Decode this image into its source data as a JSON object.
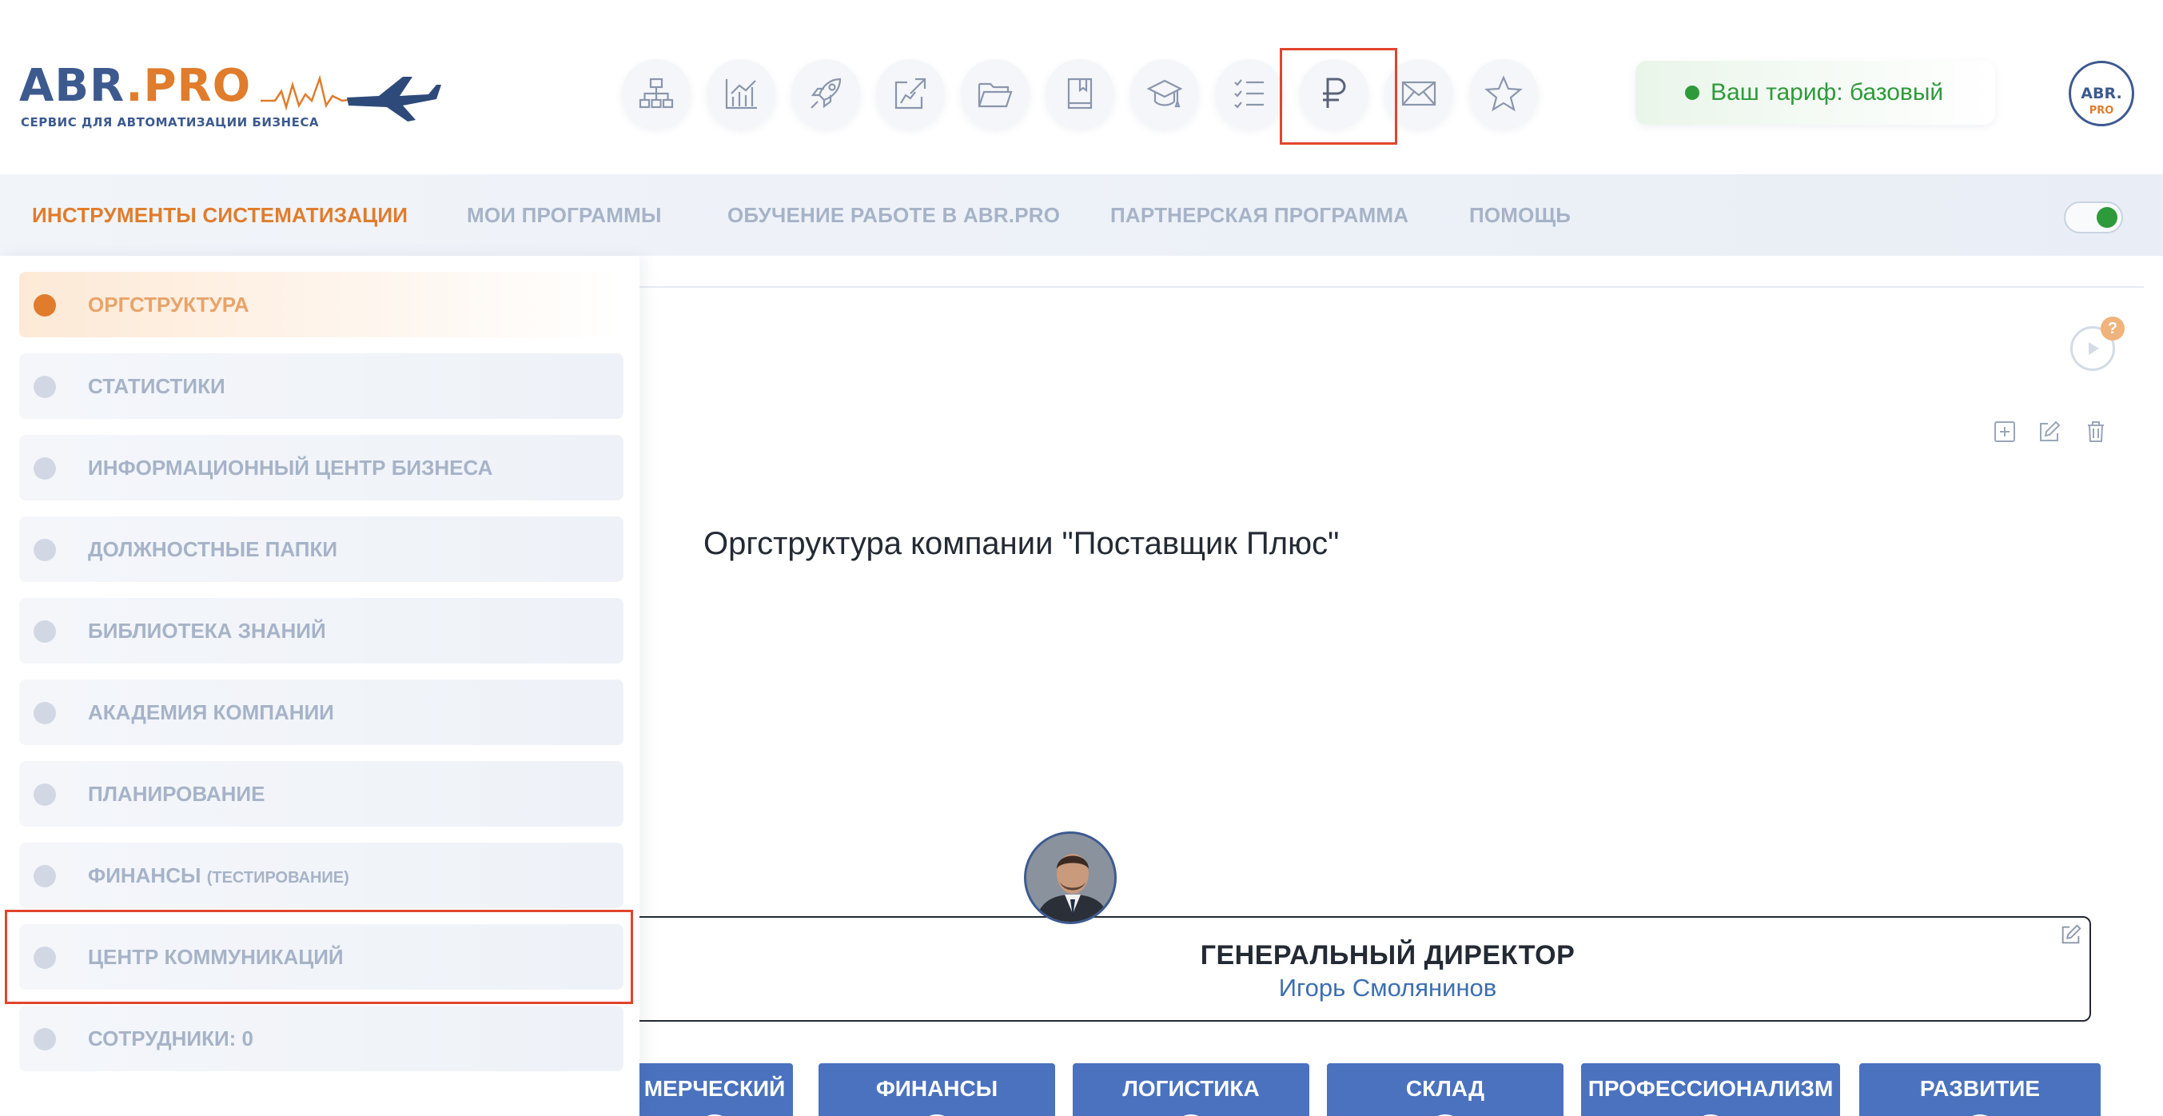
{
  "colors": {
    "brand_blue": "#3d5a8f",
    "brand_orange": "#e07c2c",
    "nav_inactive": "#a6b3c7",
    "status_green": "#2e9a3a",
    "dept_blue": "#4a72bf",
    "highlight_red": "#e0452c"
  },
  "logo": {
    "brand_abr": "ABR",
    "brand_dot": ".",
    "brand_pro": "PRO",
    "tagline": "СЕРВИС ДЛЯ АВТОМАТИЗАЦИИ БИЗНЕСА",
    "avatar_abr": "ABR.",
    "avatar_pro": "PRO"
  },
  "toolbar": {
    "icons": [
      "org-chart-icon",
      "chart-icon",
      "rocket-icon",
      "share-icon",
      "folder-icon",
      "book-icon",
      "graduation-cap-icon",
      "checklist-icon",
      "ruble-icon",
      "envelope-icon",
      "star-icon"
    ],
    "highlighted": "ruble-icon"
  },
  "tariff": {
    "label": "Ваш тариф: базовый"
  },
  "nav": {
    "items": [
      "ИНСТРУМЕНТЫ СИСТЕМАТИЗАЦИИ",
      "МОИ ПРОГРАММЫ",
      "ОБУЧЕНИЕ РАБОТЕ В ABR.PRO",
      "ПАРТНЕРСКАЯ ПРОГРАММА",
      "ПОМОЩЬ"
    ],
    "active_index": 0,
    "toggle_on": true
  },
  "sidebar": {
    "items": [
      {
        "label": "ОРГСТРУКТУРА",
        "small": ""
      },
      {
        "label": "СТАТИСТИКИ",
        "small": ""
      },
      {
        "label": "ИНФОРМАЦИОННЫЙ ЦЕНТР БИЗНЕСА",
        "small": ""
      },
      {
        "label": "ДОЛЖНОСТНЫЕ ПАПКИ",
        "small": ""
      },
      {
        "label": "БИБЛИОТЕКА ЗНАНИЙ",
        "small": ""
      },
      {
        "label": "АКАДЕМИЯ КОМПАНИИ",
        "small": ""
      },
      {
        "label": "ПЛАНИРОВАНИЕ",
        "small": ""
      },
      {
        "label": "ФИНАНСЫ",
        "small": "(ТЕСТИРОВАНИЕ)"
      },
      {
        "label": "ЦЕНТР КОММУНИКАЦИЙ",
        "small": ""
      },
      {
        "label": "СОТРУДНИКИ: 0",
        "small": ""
      }
    ],
    "active_index": 0,
    "highlighted_index": 8
  },
  "main": {
    "help_badge": "?",
    "org_title": "Оргструктура компании \"Поставщик Плюс\"",
    "ceo": {
      "role": "ГЕНЕРАЛЬНЫЙ ДИРЕКТОР",
      "name": "Игорь Смолянинов"
    },
    "departments": [
      "МЕРЧЕСКИЙ",
      "ФИНАНСЫ",
      "ЛОГИСТИКА",
      "СКЛАД",
      "ПРОФЕССИОНАЛИЗМ",
      "РАЗВИТИЕ"
    ]
  }
}
